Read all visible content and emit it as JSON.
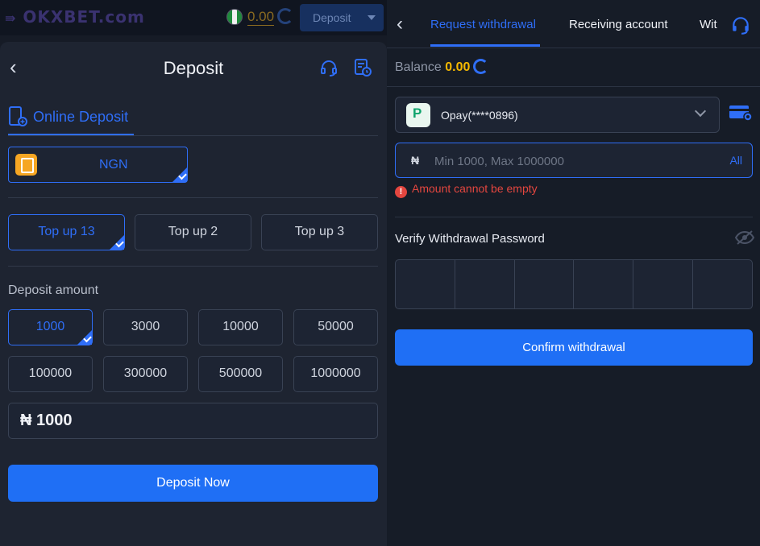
{
  "topbar": {
    "logo": "OKXBET.com",
    "balance": "0.00",
    "deposit_label": "Deposit"
  },
  "deposit": {
    "title": "Deposit",
    "method_tab": "Online Deposit",
    "currency": "NGN",
    "topups": [
      "Top up 13",
      "Top up 2",
      "Top up 3"
    ],
    "amount_label": "Deposit amount",
    "amounts": [
      "1000",
      "3000",
      "10000",
      "50000",
      "100000",
      "300000",
      "500000",
      "1000000"
    ],
    "amount_value": "₦ 1000",
    "submit": "Deposit Now"
  },
  "withdraw": {
    "tabs": [
      "Request withdrawal",
      "Receiving account",
      "Wit"
    ],
    "balance_label": "Balance",
    "balance_value": "0.00",
    "account": "Opay(****0896)",
    "currency_symbol": "₦",
    "amount_placeholder": "Min 1000, Max 1000000",
    "all_label": "All",
    "error": "Amount cannot be empty",
    "password_label": "Verify Withdrawal Password",
    "confirm": "Confirm withdrawal"
  },
  "colors": {
    "accent": "#2f6ef7",
    "button": "#1f6ff5",
    "balance": "#f5b800",
    "error": "#e4463f"
  }
}
